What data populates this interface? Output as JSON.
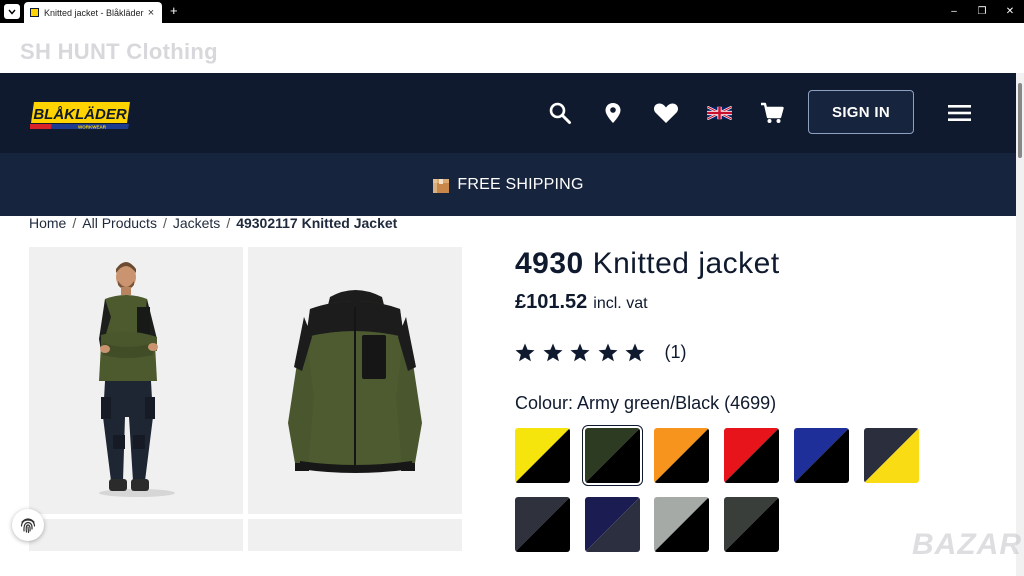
{
  "browser": {
    "tab_title": "Knitted jacket - Blåkläder",
    "tab_close": "×",
    "new_tab": "+",
    "controls": [
      "–",
      "❐",
      "✕"
    ]
  },
  "store_banner": {
    "name": "SH HUNT Clothing"
  },
  "header": {
    "logo_text": "BLÅKLÄDER",
    "logo_subtext": "WORKWEAR",
    "signin_label": "SIGN IN",
    "icons": [
      "search-icon",
      "location-pin-icon",
      "heart-icon",
      "uk-flag-icon",
      "cart-icon",
      "hamburger-menu-icon"
    ]
  },
  "shipping": {
    "label": "FREE SHIPPING"
  },
  "breadcrumb": {
    "items": [
      "Home",
      "All Products",
      "Jackets",
      "49302117 Knitted Jacket"
    ],
    "separator": "/"
  },
  "product": {
    "code": "4930",
    "name": "Knitted jacket",
    "price": "£101.52",
    "vat_label": "incl. vat",
    "rating_value": 5,
    "rating_max": 5,
    "review_count": "(1)",
    "colour_label": "Colour: Army green/Black (4699)",
    "swatches": [
      {
        "name": "yellow-black",
        "top": "#f5e50c",
        "bottom": "#000000",
        "selected": false
      },
      {
        "name": "army-green-black",
        "top": "#2d3b22",
        "bottom": "#000000",
        "selected": true
      },
      {
        "name": "orange-black",
        "top": "#f7941d",
        "bottom": "#000000",
        "selected": false
      },
      {
        "name": "red-black",
        "top": "#e8141b",
        "bottom": "#000000",
        "selected": false
      },
      {
        "name": "cornflower-blue-black",
        "top": "#1f2f99",
        "bottom": "#000000",
        "selected": false
      },
      {
        "name": "navy-yellow",
        "top": "#2b2e3d",
        "bottom": "#f9dc14",
        "selected": false
      },
      {
        "name": "dark-grey-black",
        "top": "#2f323c",
        "bottom": "#000000",
        "selected": false
      },
      {
        "name": "navy-blue",
        "top": "#1b1d52",
        "bottom": "#2c2f3f",
        "selected": false
      },
      {
        "name": "grey-melange-black",
        "top": "#a6aaa7",
        "bottom": "#000000",
        "selected": false
      },
      {
        "name": "dark-olive-black",
        "top": "#3a3e3b",
        "bottom": "#000000",
        "selected": false
      }
    ]
  },
  "watermark": "BAZAR",
  "colors": {
    "header_bg": "#0f1a2e",
    "shipping_bg": "#17243d",
    "gallery_bg": "#f0f0f0",
    "text_dark": "#0f1a2e"
  }
}
